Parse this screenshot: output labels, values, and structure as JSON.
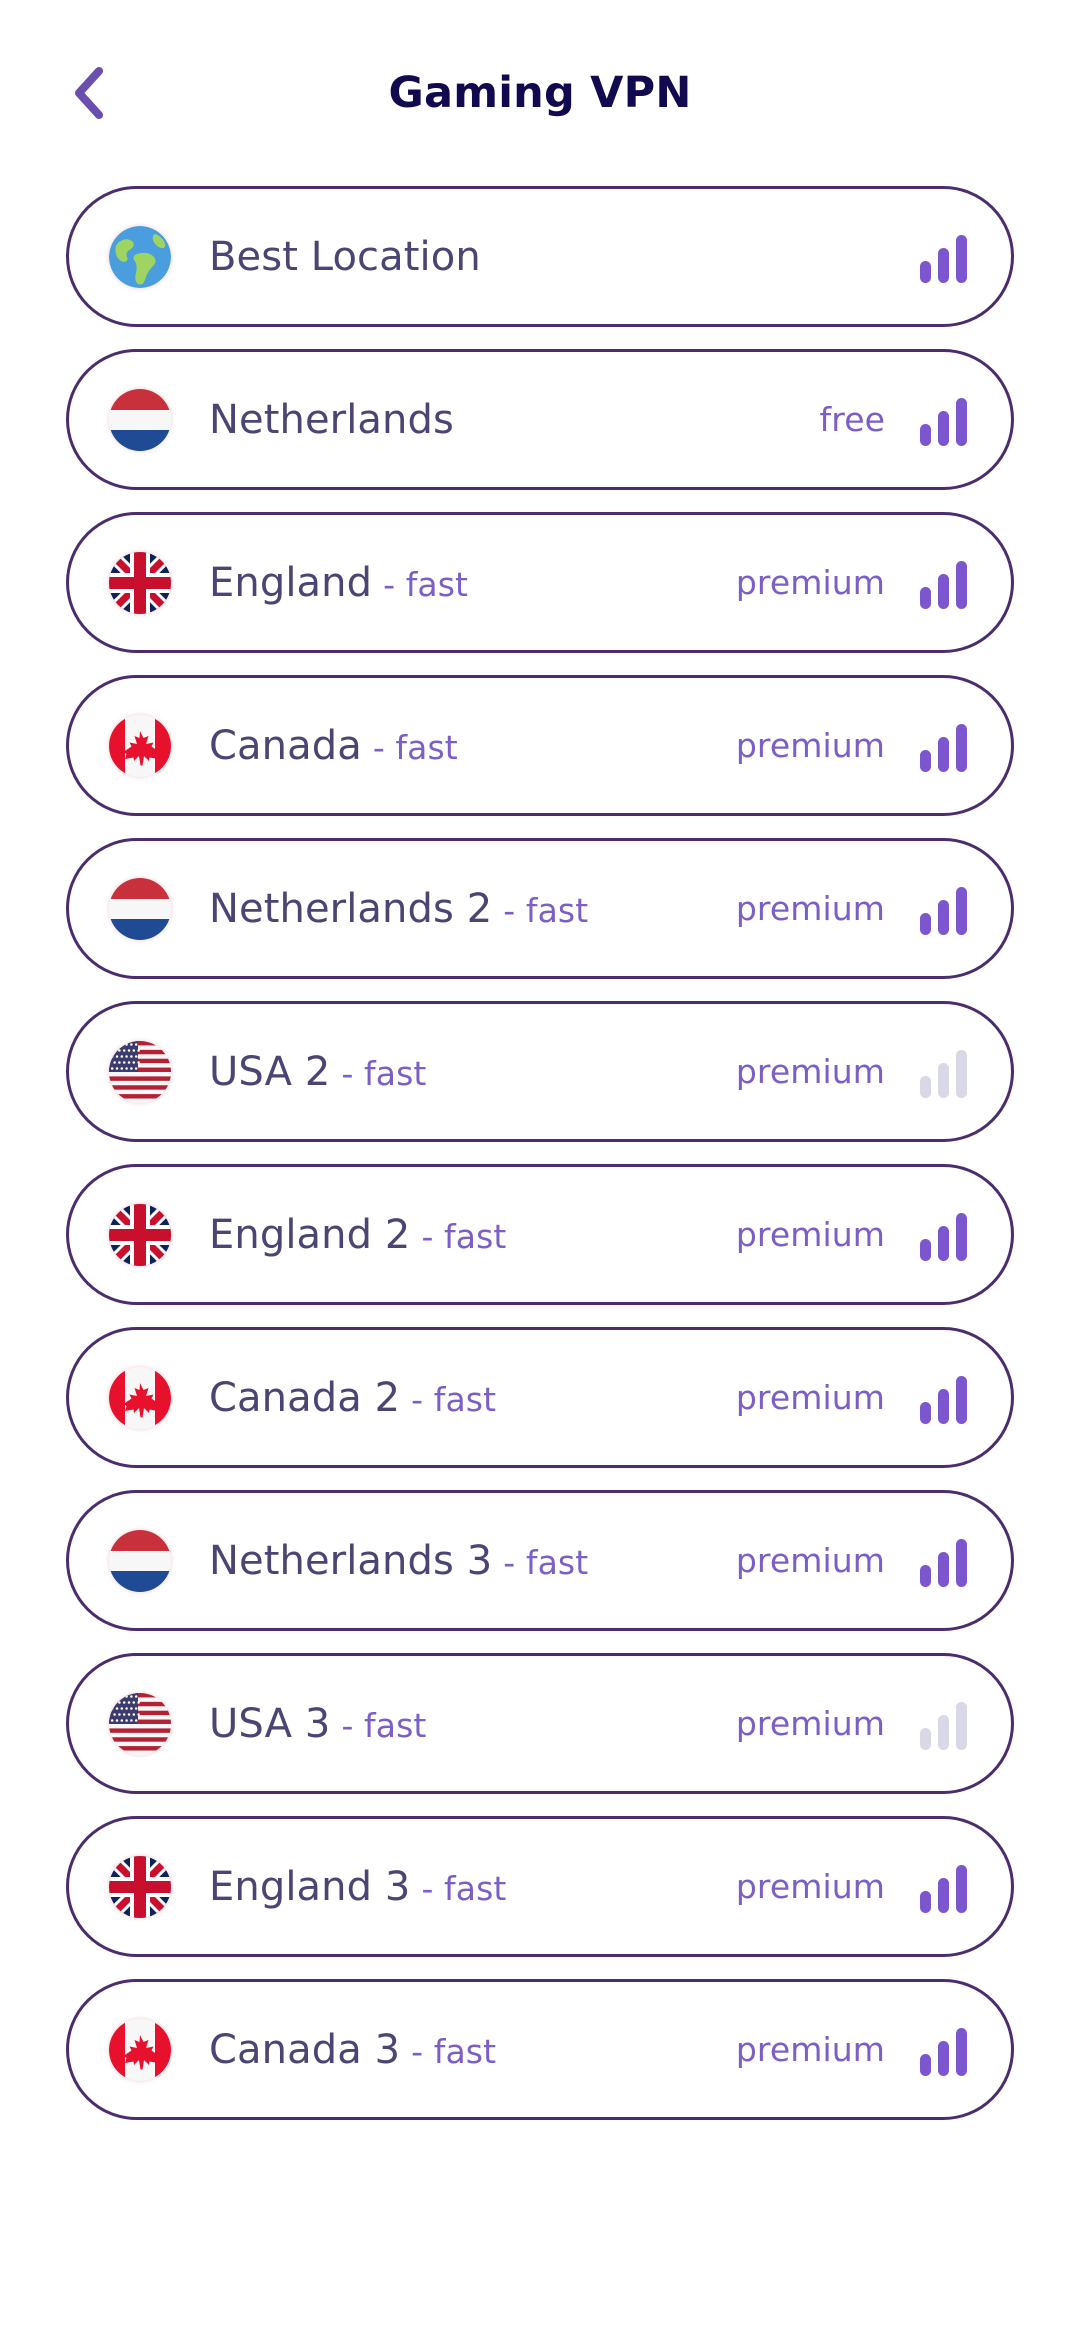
{
  "header": {
    "title": "Gaming VPN",
    "back_icon": "chevron-left-icon"
  },
  "colors": {
    "title": "#120a4f",
    "border": "#4b2c6e",
    "accent": "#7b56cf",
    "name_text": "#4a4573",
    "muted_bars": "#d9d8e6",
    "background": "#ffffff"
  },
  "server_list": [
    {
      "flag": "globe-icon",
      "name": "Best Location",
      "suffix": "",
      "tier": "",
      "signal": "on",
      "signal_bars": 3
    },
    {
      "flag": "flag-netherlands",
      "name": "Netherlands",
      "suffix": "",
      "tier": "free",
      "signal": "on",
      "signal_bars": 3
    },
    {
      "flag": "flag-england",
      "name": "England",
      "suffix": "- fast",
      "tier": "premium",
      "signal": "on",
      "signal_bars": 3
    },
    {
      "flag": "flag-canada",
      "name": "Canada",
      "suffix": "- fast",
      "tier": "premium",
      "signal": "on",
      "signal_bars": 3
    },
    {
      "flag": "flag-netherlands",
      "name": "Netherlands 2",
      "suffix": "- fast",
      "tier": "premium",
      "signal": "on",
      "signal_bars": 3
    },
    {
      "flag": "flag-usa",
      "name": "USA 2",
      "suffix": "- fast",
      "tier": "premium",
      "signal": "off",
      "signal_bars": 3
    },
    {
      "flag": "flag-england",
      "name": "England 2",
      "suffix": "- fast",
      "tier": "premium",
      "signal": "on",
      "signal_bars": 3
    },
    {
      "flag": "flag-canada",
      "name": "Canada 2",
      "suffix": "- fast",
      "tier": "premium",
      "signal": "on",
      "signal_bars": 3
    },
    {
      "flag": "flag-netherlands",
      "name": "Netherlands 3",
      "suffix": "- fast",
      "tier": "premium",
      "signal": "on",
      "signal_bars": 3
    },
    {
      "flag": "flag-usa",
      "name": "USA 3",
      "suffix": "- fast",
      "tier": "premium",
      "signal": "off",
      "signal_bars": 3
    },
    {
      "flag": "flag-england",
      "name": "England 3",
      "suffix": "- fast",
      "tier": "premium",
      "signal": "on",
      "signal_bars": 3
    },
    {
      "flag": "flag-canada",
      "name": "Canada 3",
      "suffix": "- fast",
      "tier": "premium",
      "signal": "on",
      "signal_bars": 3
    }
  ]
}
